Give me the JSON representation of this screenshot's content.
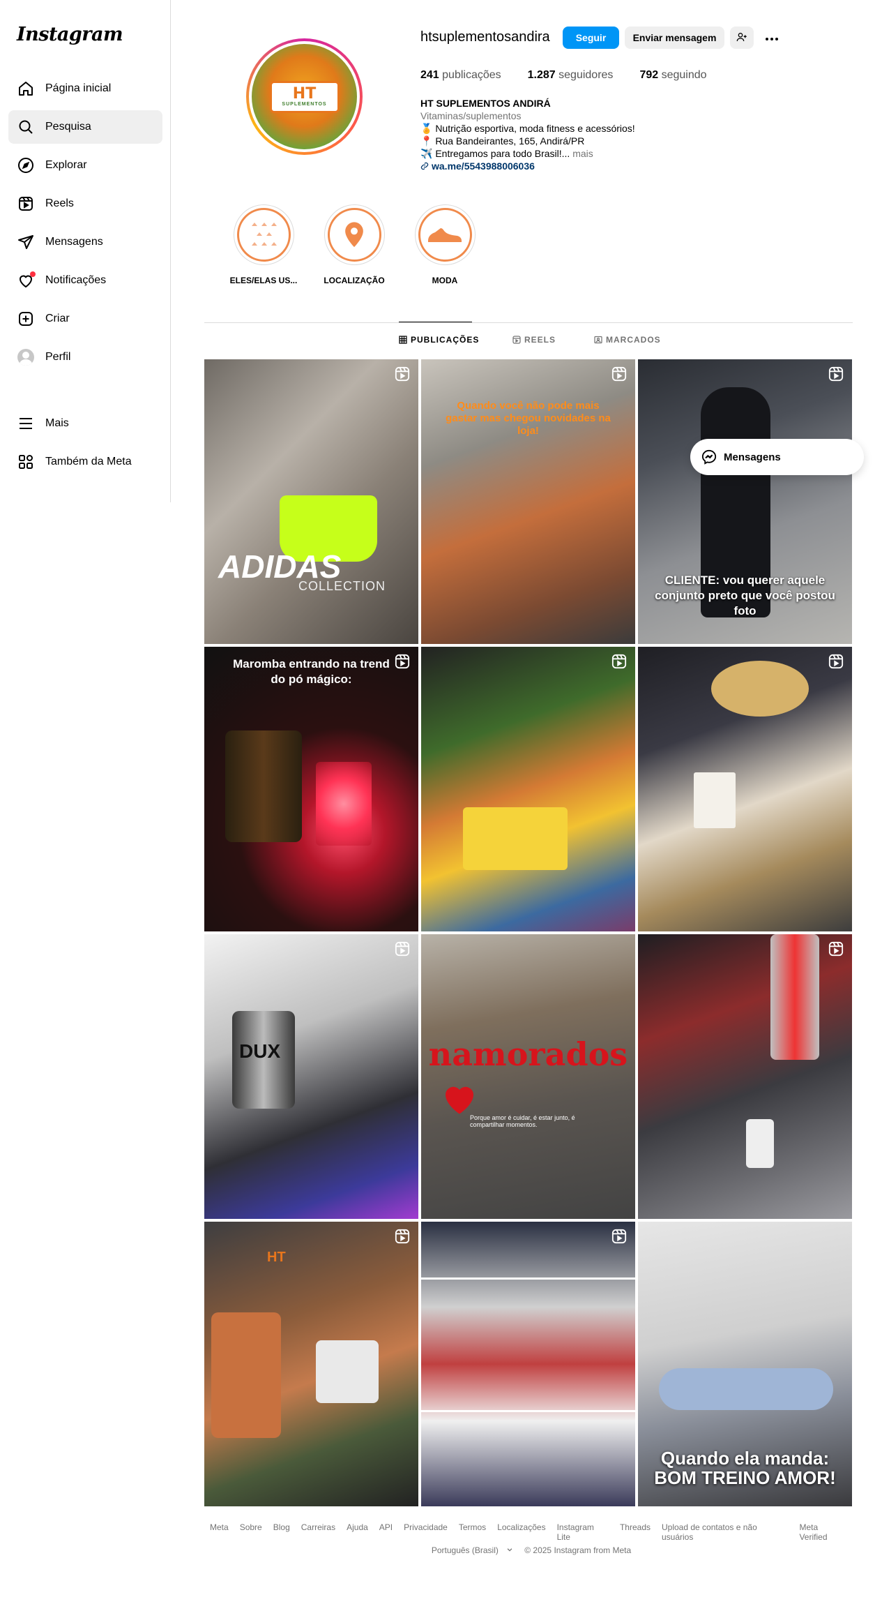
{
  "sidebar": {
    "logo": "Instagram",
    "items": [
      {
        "label": "Página inicial",
        "icon": "home-icon"
      },
      {
        "label": "Pesquisa",
        "icon": "search-icon"
      },
      {
        "label": "Explorar",
        "icon": "compass-icon"
      },
      {
        "label": "Reels",
        "icon": "reels-icon"
      },
      {
        "label": "Mensagens",
        "icon": "send-icon"
      },
      {
        "label": "Notificações",
        "icon": "heart-icon"
      },
      {
        "label": "Criar",
        "icon": "plus-square-icon"
      },
      {
        "label": "Perfil",
        "icon": "avatar"
      }
    ],
    "more": {
      "label": "Mais",
      "icon": "menu-icon"
    },
    "meta": {
      "label": "Também da Meta",
      "icon": "meta-apps-icon"
    }
  },
  "profile": {
    "username": "htsuplementosandira",
    "follow_label": "Seguir",
    "message_label": "Enviar mensagem",
    "avatar_text": "HT",
    "avatar_subtext": "SUPLEMENTOS",
    "stats": {
      "posts_count": "241",
      "posts_label": "publicações",
      "followers_count": "1.287",
      "followers_label": "seguidores",
      "following_count": "792",
      "following_label": "seguindo"
    },
    "bio": {
      "full_name": "HT SUPLEMENTOS ANDIRÁ",
      "category": "Vitaminas/suplementos",
      "line1": "🏅 Nutrição esportiva, moda fitness e acessórios!",
      "line2": "📍 Rua Bandeirantes, 165, Andirá/PR",
      "line3": "✈️ Entregamos para todo Brasil!...",
      "more": "mais",
      "link": "wa.me/5543988006036"
    }
  },
  "highlights": [
    {
      "label": "ELES/ELAS US..."
    },
    {
      "label": "LOCALIZAÇÃO"
    },
    {
      "label": "MODA"
    }
  ],
  "tabs": [
    {
      "label": "PUBLICAÇÕES"
    },
    {
      "label": "REELS"
    },
    {
      "label": "MARCADOS"
    }
  ],
  "posts": [
    {
      "text": "ADIDAS",
      "subtext": "COLLECTION"
    },
    {
      "text": "Quando você não pode mais gastar mas chegou novidades na loja!"
    },
    {
      "text": "CLIENTE: vou querer aquele conjunto preto que você postou foto"
    },
    {
      "text": "Maromba entrando na trend do pó mágico:"
    },
    {
      "text": ""
    },
    {
      "text": ""
    },
    {
      "text": "DUX"
    },
    {
      "text": "namorados",
      "subtext": "Porque amor é cuidar, é estar junto, é compartilhar momentos."
    },
    {
      "text": ""
    },
    {
      "text": "HT"
    },
    {
      "text": ""
    },
    {
      "text": "Quando ela manda: BOM TREINO AMOR!"
    }
  ],
  "floating": {
    "label": "Mensagens"
  },
  "footer": {
    "links": [
      "Meta",
      "Sobre",
      "Blog",
      "Carreiras",
      "Ajuda",
      "API",
      "Privacidade",
      "Termos",
      "Localizações",
      "Instagram Lite",
      "Threads",
      "Upload de contatos e não usuários",
      "Meta Verified"
    ],
    "language": "Português (Brasil)",
    "copyright": "© 2025 Instagram from Meta"
  },
  "colors": {
    "accent": "#0095f6",
    "link": "#00376b",
    "notification": "#ff3040",
    "highlight_ring": "#f08a4b"
  }
}
